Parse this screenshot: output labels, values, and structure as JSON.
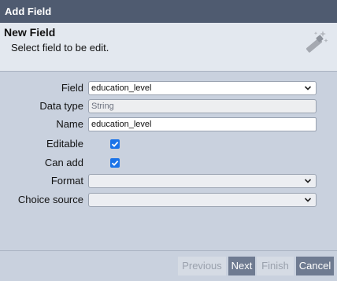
{
  "window": {
    "title": "Add Field"
  },
  "header": {
    "title": "New Field",
    "subtitle": "Select field to be edit.",
    "icon": "magic-wand-icon"
  },
  "form": {
    "field": {
      "label": "Field",
      "value": "education_level"
    },
    "data_type": {
      "label": "Data type",
      "value": "String"
    },
    "name": {
      "label": "Name",
      "value": "education_level"
    },
    "editable": {
      "label": "Editable",
      "checked": true
    },
    "can_add": {
      "label": "Can add",
      "checked": true
    },
    "format": {
      "label": "Format",
      "value": ""
    },
    "choice_source": {
      "label": "Choice source",
      "value": ""
    }
  },
  "footer": {
    "previous_label": "Previous",
    "next_label": "Next",
    "finish_label": "Finish",
    "cancel_label": "Cancel"
  },
  "colors": {
    "titlebar": "#4f5b70",
    "background": "#c9d1de",
    "checkbox": "#1a73e8",
    "active_button": "#6f7b91"
  }
}
